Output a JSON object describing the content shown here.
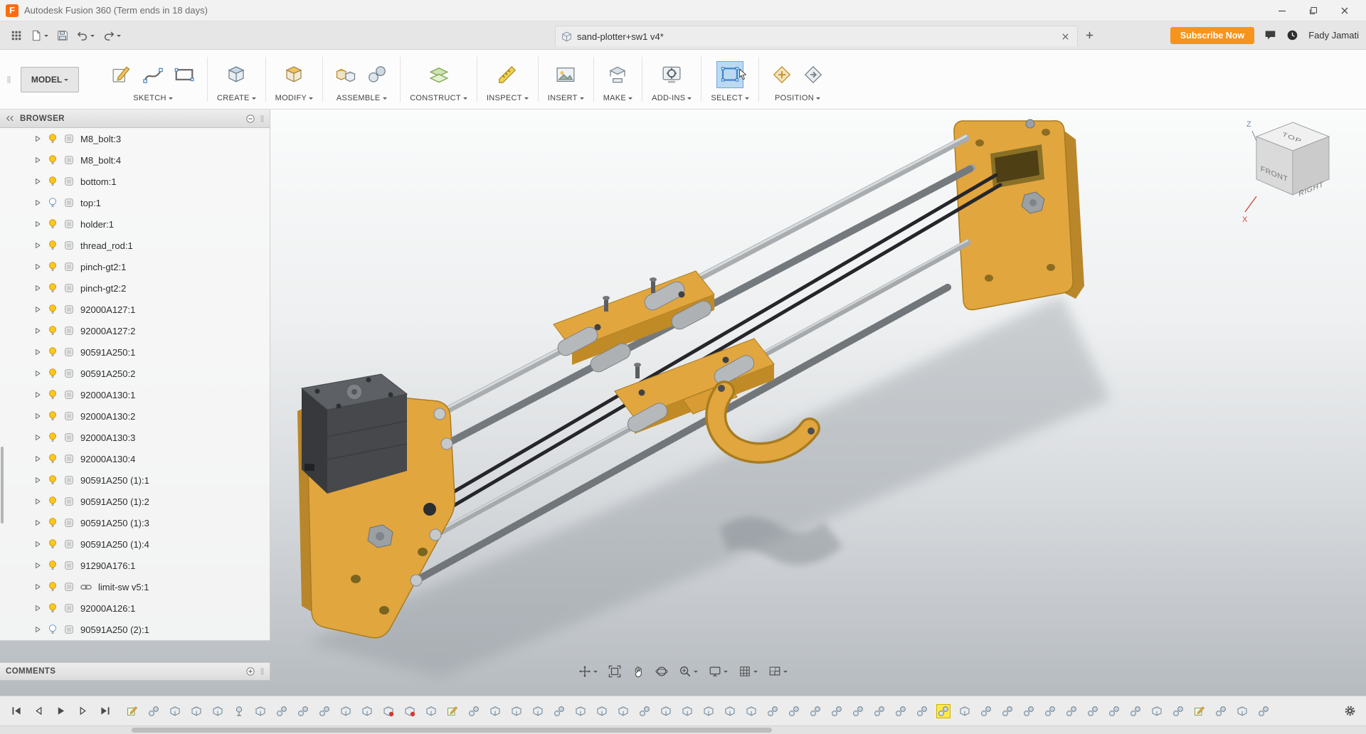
{
  "titlebar": {
    "logo_letter": "F",
    "app_title": "Autodesk Fusion 360 (Term ends in 18 days)"
  },
  "appbar": {
    "tools": [
      {
        "name": "app-launcher-button",
        "icon": "grid-icon",
        "caret": false
      },
      {
        "name": "file-menu-button",
        "icon": "file-icon",
        "caret": true
      },
      {
        "name": "save-button",
        "icon": "save-icon",
        "caret": false
      },
      {
        "name": "undo-button",
        "icon": "undo-icon",
        "caret": true
      },
      {
        "name": "redo-button",
        "icon": "redo-icon",
        "caret": true
      }
    ],
    "document_tab": {
      "icon": "model-cube-icon",
      "label": "sand-plotter+sw1 v4*"
    },
    "subscribe_label": "Subscribe Now",
    "username": "Fady Jamati"
  },
  "ribbon": {
    "workspace_label": "MODEL",
    "groups": [
      {
        "label": "SKETCH",
        "icons": [
          "sketch-create-icon",
          "sketch-spline-icon",
          "sketch-rect-icon"
        ]
      },
      {
        "label": "CREATE",
        "icons": [
          "create-icon"
        ]
      },
      {
        "label": "MODIFY",
        "icons": [
          "modify-icon"
        ]
      },
      {
        "label": "ASSEMBLE",
        "icons": [
          "assemble-icon",
          "joint-icon"
        ]
      },
      {
        "label": "CONSTRUCT",
        "icons": [
          "construct-icon"
        ]
      },
      {
        "label": "INSPECT",
        "icons": [
          "inspect-icon"
        ]
      },
      {
        "label": "INSERT",
        "icons": [
          "insert-icon"
        ]
      },
      {
        "label": "MAKE",
        "icons": [
          "make-icon"
        ]
      },
      {
        "label": "ADD-INS",
        "icons": [
          "addins-icon"
        ]
      },
      {
        "label": "SELECT",
        "icons": [
          "select-icon"
        ],
        "active": true
      },
      {
        "label": "POSITION",
        "icons": [
          "position-capture-icon",
          "position-revert-icon"
        ]
      }
    ]
  },
  "browser": {
    "header": "BROWSER",
    "items": [
      {
        "label": "M8_bolt:3",
        "visible": true
      },
      {
        "label": "M8_bolt:4",
        "visible": true
      },
      {
        "label": "bottom:1",
        "visible": true
      },
      {
        "label": "top:1",
        "visible": false
      },
      {
        "label": "holder:1",
        "visible": true
      },
      {
        "label": "thread_rod:1",
        "visible": true
      },
      {
        "label": "pinch-gt2:1",
        "visible": true
      },
      {
        "label": "pinch-gt2:2",
        "visible": true
      },
      {
        "label": "92000A127:1",
        "visible": true
      },
      {
        "label": "92000A127:2",
        "visible": true
      },
      {
        "label": "90591A250:1",
        "visible": true
      },
      {
        "label": "90591A250:2",
        "visible": true
      },
      {
        "label": "92000A130:1",
        "visible": true
      },
      {
        "label": "92000A130:2",
        "visible": true
      },
      {
        "label": "92000A130:3",
        "visible": true
      },
      {
        "label": "92000A130:4",
        "visible": true
      },
      {
        "label": "90591A250 (1):1",
        "visible": true
      },
      {
        "label": "90591A250 (1):2",
        "visible": true
      },
      {
        "label": "90591A250 (1):3",
        "visible": true
      },
      {
        "label": "90591A250 (1):4",
        "visible": true
      },
      {
        "label": "91290A176:1",
        "visible": true
      },
      {
        "label": "limit-sw v5:1",
        "visible": true,
        "linked": true
      },
      {
        "label": "92000A126:1",
        "visible": true
      },
      {
        "label": "90591A250 (2):1",
        "visible": false
      }
    ]
  },
  "comments": {
    "header": "COMMENTS"
  },
  "viewcube": {
    "top": "TOP",
    "front": "FRONT",
    "right": "RIGHT",
    "z": "Z",
    "x": "X"
  },
  "navbar": {
    "items": [
      {
        "icon": "nav-pan-icon",
        "caret": true
      },
      {
        "icon": "nav-fit-icon",
        "caret": false
      },
      {
        "icon": "nav-pan-hand-icon",
        "caret": false
      },
      {
        "icon": "nav-orbit-icon",
        "caret": false
      },
      {
        "icon": "nav-zoom-icon",
        "caret": true
      },
      {
        "icon": "nav-display-icon",
        "caret": true
      },
      {
        "icon": "nav-grid-icon",
        "caret": true
      },
      {
        "icon": "nav-viewports-icon",
        "caret": true
      }
    ]
  },
  "timeline": {
    "playback": [
      "tl-start-icon",
      "tl-prev-icon",
      "tl-play-icon",
      "tl-next-icon",
      "tl-end-icon"
    ],
    "highlight_index": 38,
    "items": [
      "sketch",
      "joint",
      "comp",
      "comp",
      "comp",
      "ground",
      "comp",
      "joint",
      "joint",
      "joint",
      "comp",
      "comp",
      "warn",
      "warn",
      "comp",
      "sketch",
      "joint",
      "comp",
      "comp",
      "comp",
      "joint",
      "comp",
      "comp",
      "comp",
      "joint",
      "comp",
      "comp",
      "comp",
      "comp",
      "comp",
      "joint",
      "joint",
      "joint",
      "joint",
      "joint",
      "joint",
      "joint",
      "joint",
      "joint",
      "comp",
      "joint",
      "joint",
      "joint",
      "joint",
      "joint",
      "joint",
      "joint",
      "joint",
      "comp",
      "joint",
      "sketch",
      "joint",
      "comp",
      "joint"
    ]
  }
}
